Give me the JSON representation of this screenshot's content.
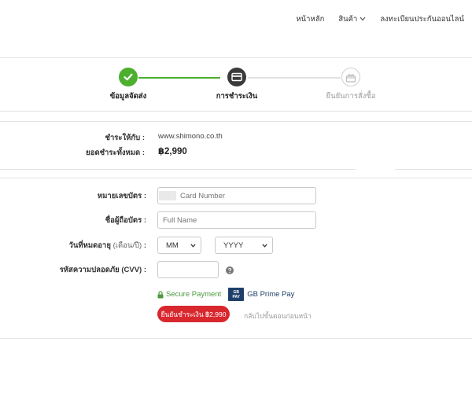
{
  "nav": {
    "home": "หน้าหลัก",
    "products": "สินค้า",
    "register": "ลงทะเบียนประกันออนไลน์"
  },
  "steps": [
    {
      "label": "ข้อมูลจัดส่ง",
      "status": "complete",
      "icon": "check-icon"
    },
    {
      "label": "การชำระเงิน",
      "status": "active",
      "icon": "credit-card-icon"
    },
    {
      "label": "ยืนยันการสั่งซื้อ",
      "status": "pending",
      "icon": "gift-icon"
    }
  ],
  "summary": {
    "pay_to_label": "ชำระให้กับ :",
    "pay_to_value": "www.shimono.co.th",
    "total_label": "ยอดชำระทั้งหมด :",
    "total_value": "฿2,990"
  },
  "form": {
    "card_number_label": "หมายเลขบัตร :",
    "card_number_placeholder": "Card Number",
    "card_holder_label": "ชื่อผู้ถือบัตร :",
    "card_holder_placeholder": "Full Name",
    "expiry_label": "วันที่หมดอายุ",
    "expiry_sub": "(เดือน/ปี)",
    "expiry_colon": " :",
    "month_value": "MM",
    "year_value": "YYYY",
    "cvv_label": "รหัสความปลอดภัย (CVV) :",
    "cvv_value": ""
  },
  "secure": {
    "label": "Secure Payment",
    "gb_logo_top": "GB",
    "gb_logo_bottom": "PAY",
    "gb_text": "GB Prime Pay"
  },
  "actions": {
    "pay_button": "ยืนยันชำระเงิน ฿2,990",
    "back_link": "กลับไปขั้นตอนก่อนหน้า"
  },
  "colors": {
    "complete": "#4caf2e",
    "active": "#3a3a3a",
    "pending": "#cccccc",
    "accent": "#d9272e",
    "secure": "#4a9a3c"
  }
}
